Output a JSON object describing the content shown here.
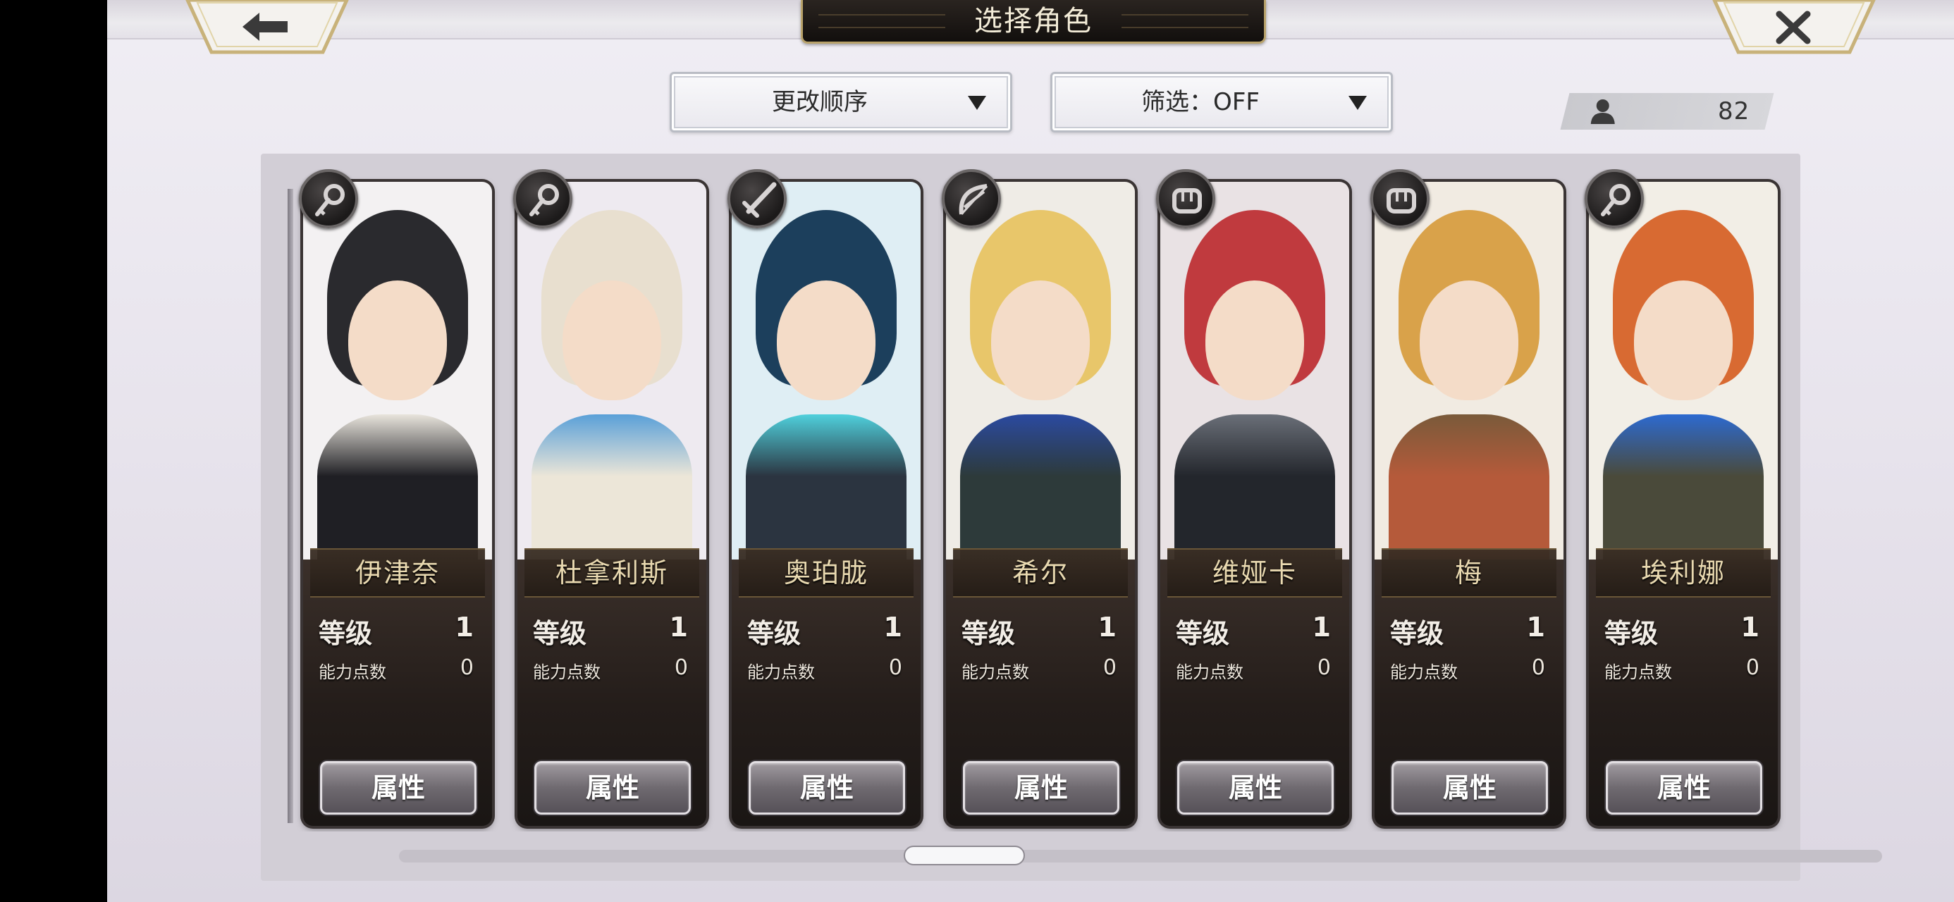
{
  "header": {
    "title": "选择角色",
    "back_icon": "arrow-left-icon",
    "close_icon": "close-icon"
  },
  "controls": {
    "sort_label": "更改顺序",
    "filter_label": "筛选：OFF"
  },
  "roster": {
    "count_icon": "person-icon",
    "count": "82"
  },
  "cards": [
    {
      "name": "伊津奈",
      "level_label": "等级",
      "level": "1",
      "ap_label": "能力点数",
      "ap": "0",
      "button": "属性",
      "class_icon": "key-icon"
    },
    {
      "name": "杜拿利斯",
      "level_label": "等级",
      "level": "1",
      "ap_label": "能力点数",
      "ap": "0",
      "button": "属性",
      "class_icon": "key-icon"
    },
    {
      "name": "奥珀胧",
      "level_label": "等级",
      "level": "1",
      "ap_label": "能力点数",
      "ap": "0",
      "button": "属性",
      "class_icon": "sword-icon"
    },
    {
      "name": "希尔",
      "level_label": "等级",
      "level": "1",
      "ap_label": "能力点数",
      "ap": "0",
      "button": "属性",
      "class_icon": "bow-icon"
    },
    {
      "name": "维娅卡",
      "level_label": "等级",
      "level": "1",
      "ap_label": "能力点数",
      "ap": "0",
      "button": "属性",
      "class_icon": "fist-icon"
    },
    {
      "name": "梅",
      "level_label": "等级",
      "level": "1",
      "ap_label": "能力点数",
      "ap": "0",
      "button": "属性",
      "class_icon": "fist-icon"
    },
    {
      "name": "埃利娜",
      "level_label": "等级",
      "level": "1",
      "ap_label": "能力点数",
      "ap": "0",
      "button": "属性",
      "class_icon": "key-icon"
    }
  ],
  "colors": {
    "title_bg": "#1a1512",
    "title_border": "#b8a26a",
    "name_text": "#e9d9b0"
  }
}
